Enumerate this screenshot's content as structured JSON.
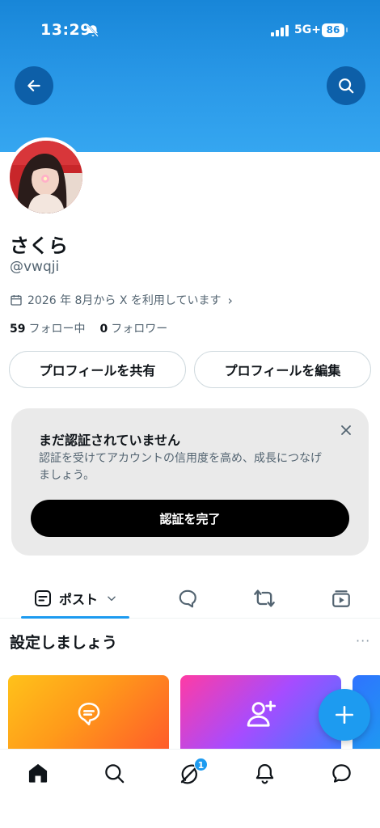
{
  "status_bar": {
    "time": "13:29",
    "network": "5G+",
    "battery": "86"
  },
  "header": {
    "back_icon": "arrow-left-icon",
    "search_icon": "search-icon"
  },
  "profile": {
    "display_name": "さくら",
    "handle": "@vwqji",
    "joined": "2026 年 8月から X を利用しています",
    "following_count": "59",
    "following_label": "フォロー中",
    "followers_count": "0",
    "followers_label": "フォロワー"
  },
  "actions": {
    "share_label": "プロフィールを共有",
    "edit_label": "プロフィールを編集"
  },
  "verify": {
    "title": "まだ認証されていません",
    "description": "認証を受けてアカウントの信用度を高め、成長につなげましょう。",
    "button_label": "認証を完了"
  },
  "tabs": {
    "posts_label": "ポスト"
  },
  "setup": {
    "title": "設定しましょう",
    "more": "···"
  },
  "bottom_nav": {
    "badge_count": "1"
  },
  "colors": {
    "accent": "#1d9bf0",
    "banner": "#2a99e8",
    "header_button": "#0d5fa8"
  }
}
